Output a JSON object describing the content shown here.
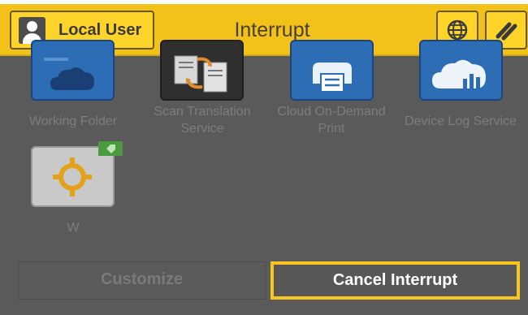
{
  "header": {
    "user_label": "Local User",
    "title": "Interrupt",
    "language_icon": "globe-icon",
    "menu_icon": "double-slash-icon"
  },
  "apps": [
    {
      "label": "Working Folder",
      "icon": "folder-cloud-icon"
    },
    {
      "label": "Scan Translation Service",
      "icon": "scan-translation-icon"
    },
    {
      "label": "Cloud On-Demand Print",
      "icon": "cloud-print-icon"
    },
    {
      "label": "Device Log Service",
      "icon": "cloud-chart-icon"
    },
    {
      "label": "W",
      "icon": "crosshair-icon",
      "badge_icon": "tag-icon"
    }
  ],
  "footer": {
    "customize_label": "Customize",
    "cancel_label": "Cancel Interrupt"
  },
  "colors": {
    "header": "#f2c21b",
    "highlight": "#f7c51e",
    "tile_blue": "#2d6db5",
    "background": "#5a5a5a"
  }
}
